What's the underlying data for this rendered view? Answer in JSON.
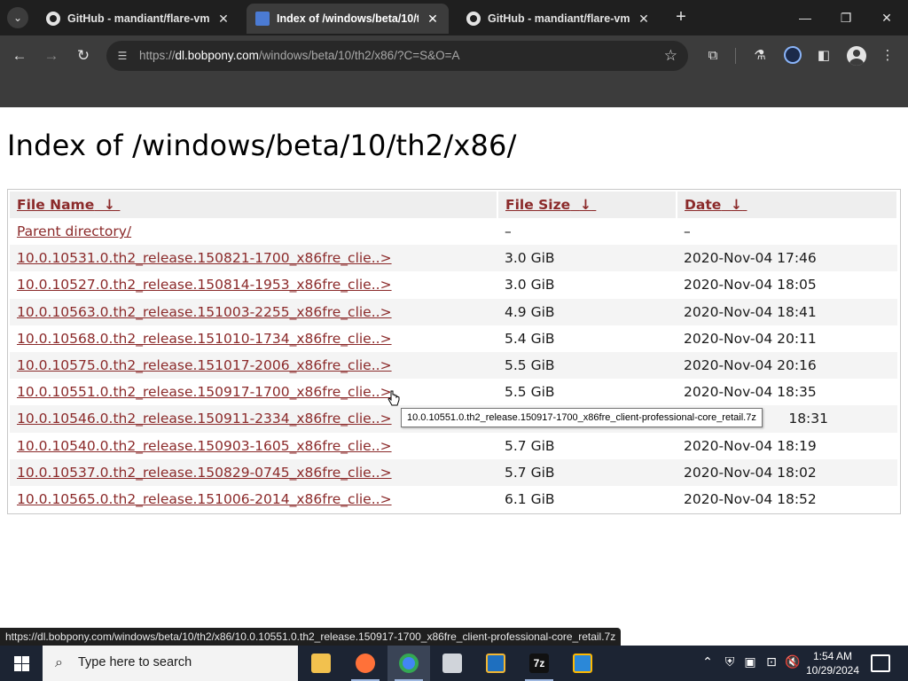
{
  "browser": {
    "tabs": [
      {
        "title": "GitHub - mandiant/flare-vm: A",
        "favicon": "github-icon",
        "active": false
      },
      {
        "title": "Index of /windows/beta/10/th2",
        "favicon": "document-icon",
        "active": true
      },
      {
        "title": "GitHub - mandiant/flare-vm: A",
        "favicon": "github-icon",
        "active": false
      }
    ],
    "new_tab": "+",
    "url_host": "dl.bobpony.com",
    "url_path": "/windows/beta/10/th2/x86/?C=S&O=A",
    "url_scheme": "https://"
  },
  "page": {
    "title": "Index of /windows/beta/10/th2/x86/",
    "headers": {
      "name": "File Name",
      "size": "File Size",
      "date": "Date",
      "sort_arrow": "↓"
    },
    "parent": {
      "name": "Parent directory/",
      "size": "–",
      "date": "–"
    },
    "rows": [
      {
        "name": "10.0.10531.0.th2_release.150821-1700_x86fre_clie..>",
        "size": "3.0 GiB",
        "date": "2020-Nov-04 17:46"
      },
      {
        "name": "10.0.10527.0.th2_release.150814-1953_x86fre_clie..>",
        "size": "3.0 GiB",
        "date": "2020-Nov-04 18:05"
      },
      {
        "name": "10.0.10563.0.th2_release.151003-2255_x86fre_clie..>",
        "size": "4.9 GiB",
        "date": "2020-Nov-04 18:41"
      },
      {
        "name": "10.0.10568.0.th2_release.151010-1734_x86fre_clie..>",
        "size": "5.4 GiB",
        "date": "2020-Nov-04 20:11"
      },
      {
        "name": "10.0.10575.0.th2_release.151017-2006_x86fre_clie..>",
        "size": "5.5 GiB",
        "date": "2020-Nov-04 20:16"
      },
      {
        "name": "10.0.10551.0.th2_release.150917-1700_x86fre_clie..>",
        "size": "5.5 GiB",
        "date": "2020-Nov-04 18:35"
      },
      {
        "name": "10.0.10546.0.th2_release.150911-2334_x86fre_clie..>",
        "size": "",
        "date": "18:31"
      },
      {
        "name": "10.0.10540.0.th2_release.150903-1605_x86fre_clie..>",
        "size": "5.7 GiB",
        "date": "2020-Nov-04 18:19"
      },
      {
        "name": "10.0.10537.0.th2_release.150829-0745_x86fre_clie..>",
        "size": "5.7 GiB",
        "date": "2020-Nov-04 18:02"
      },
      {
        "name": "10.0.10565.0.th2_release.151006-2014_x86fre_clie..>",
        "size": "6.1 GiB",
        "date": "2020-Nov-04 18:52"
      }
    ],
    "tooltip": "10.0.10551.0.th2_release.150917-1700_x86fre_client-professional-core_retail.7z"
  },
  "status_url": "https://dl.bobpony.com/windows/beta/10/th2/x86/10.0.10551.0.th2_release.150917-1700_x86fre_client-professional-core_retail.7z",
  "taskbar": {
    "search_placeholder": "Type here to search",
    "time": "1:54 AM",
    "date": "10/29/2024",
    "apps": [
      "file-explorer-icon",
      "firefox-icon",
      "chrome-icon",
      "mail-icon",
      "virtualbox-icon",
      "7zip-icon",
      "store-icon"
    ]
  }
}
